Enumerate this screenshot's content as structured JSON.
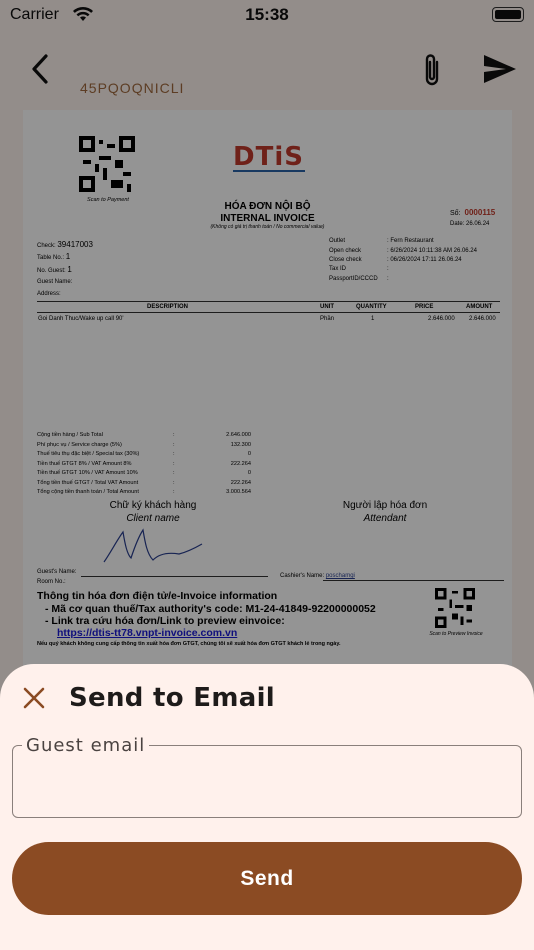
{
  "status_bar": {
    "carrier": "Carrier",
    "time": "15:38"
  },
  "nav": {
    "reference_code": "45PQOQNICLI",
    "icons": [
      "back-chevron-icon",
      "paperclip-icon",
      "send-icon"
    ]
  },
  "invoice": {
    "scan_to_payment": "Scan to Payment",
    "logo": "DTiS",
    "title_vi": "HÓA ĐƠN NỘI BỘ",
    "title_en": "INTERNAL INVOICE",
    "note": "(Không có giá trị thanh toán / No commercial value)",
    "so_label": "Số:",
    "so_value": "0000115",
    "date": "Date:  26.06.24",
    "check_label": "Check:",
    "check_value": "39417003",
    "table_label": "Table No.:",
    "table_value": "1",
    "guest_label": "No. Guest:",
    "guest_value": "1",
    "guest_name_label": "Guest Name:",
    "address_label": "Address:",
    "outlet_label": "Outlet",
    "outlet_value": ":  Fern Restaurant",
    "open_label": "Open check",
    "open_value": ":  6/26/2024 10:11:38 AM  26.06.24",
    "close_label": "Close check",
    "close_value": ":  06/26/2024 17:11  26.06.24",
    "taxid_label": "Tax ID",
    "taxid_value": ":",
    "passport_label": "PassportID/CCCD",
    "passport_value": ":",
    "col_description": "DESCRIPTION",
    "col_unit": "UNIT",
    "col_quantity": "QUANTITY",
    "col_price": "PRICE",
    "col_amount": "AMOUNT",
    "item": {
      "description": "Goi Danh Thuc/Wake up call 90'",
      "unit": "Phần",
      "quantity": "1",
      "price": "2.646.000",
      "amount": "2.646.000"
    },
    "summary": [
      {
        "label": "Cộng tiền hàng / Sub Total",
        "value": "2.646.000"
      },
      {
        "label": "Phí phục vụ / Service charge (5%)",
        "value": "132.300"
      },
      {
        "label": "Thuế tiêu thụ đặc biệt / Special tax (30%)",
        "value": "0"
      },
      {
        "label": "Tiền thuế GTGT 8% / VAT Amount 8%",
        "value": "222.264"
      },
      {
        "label": "Tiền thuế GTGT 10% / VAT Amount 10%",
        "value": "0"
      },
      {
        "label": "Tổng tiền thuế GTGT / Total VAT Amount",
        "value": "222.264"
      },
      {
        "label": "Tổng cộng tiền thanh toán / Total Amount",
        "value": "3.000.564"
      }
    ],
    "summary_colon": ":",
    "client_sig_vi": "Chữ ký khách hàng",
    "client_sig_en": "Client name",
    "attendant_vi": "Người lập hóa đơn",
    "attendant_en": "Attendant",
    "guests_name_label": "Guest's Name:",
    "room_label": "Room No.:",
    "cashier_label": "Cashier's Name:",
    "cashier_value": "poschamgi",
    "einvoice_title": "Thông tin hóa đơn điện tử/e-Invoice information",
    "tax_code_line": "- Mã cơ quan thuế/Tax authority's code: M1-24-41849-92200000052",
    "lookup_line": "- Link tra cứu hóa đơn/Link to preview einvoice:",
    "lookup_url": "https://dtis-tt78.vnpt-invoice.com.vn",
    "footer_note": "Nếu quý khách không cung cấp thông tin xuất hóa đơn GTGT, chúng tôi sẽ xuất hóa đơn GTGT khách lẻ trong ngày.",
    "scan_preview": "Scan to Preview Invoice"
  },
  "sheet": {
    "title": "Send to Email",
    "field_label": "Guest email",
    "field_value": "",
    "send_label": "Send"
  },
  "colors": {
    "accent": "#8b4b23",
    "sheet_bg": "#fff1ec",
    "reference": "#a06a3f",
    "invoice_number": "#c0392b"
  }
}
